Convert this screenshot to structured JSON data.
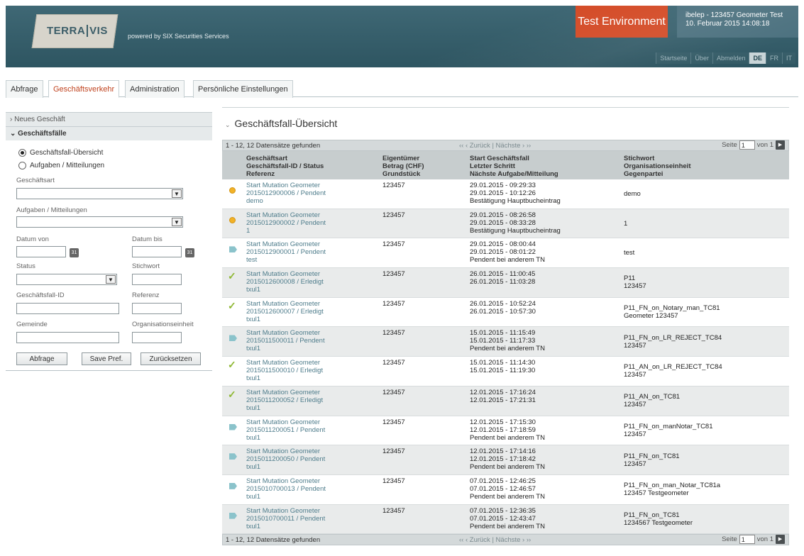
{
  "header": {
    "logo_left": "TERRA",
    "logo_right": "VIS",
    "powered_by": "powered by SIX Securities Services",
    "environment": "Test Environment",
    "user_line1": "ibelep - 123457  Geometer Test",
    "user_line2": "10. Februar 2015 14:08:18",
    "links": [
      "Startseite",
      "Über",
      "Abmelden",
      "DE",
      "FR",
      "IT"
    ],
    "active_lang": "DE"
  },
  "tabs": [
    {
      "label": "Abfrage",
      "active": false
    },
    {
      "label": "Geschäftsverkehr",
      "active": true
    },
    {
      "label": "Administration",
      "active": false
    },
    {
      "label": "Persönliche Einstellungen",
      "active": false
    }
  ],
  "sidebar": {
    "sections": [
      "Neues Geschäft",
      "Geschäftsfälle"
    ],
    "radios": [
      {
        "label": "Geschäftsfall-Übersicht",
        "checked": true
      },
      {
        "label": "Aufgaben / Mitteilungen",
        "checked": false
      }
    ],
    "labels": {
      "geschaeftsart": "Geschäftsart",
      "aufgaben": "Aufgaben / Mitteilungen",
      "datum_von": "Datum von",
      "datum_bis": "Datum bis",
      "status": "Status",
      "stichwort": "Stichwort",
      "geschaeftsfall_id": "Geschäftsfall-ID",
      "referenz": "Referenz",
      "gemeinde": "Gemeinde",
      "organisationseinheit": "Organisationseinheit"
    },
    "buttons": {
      "query": "Abfrage",
      "save": "Save Pref.",
      "reset": "Zurücksetzen"
    }
  },
  "main": {
    "title": "Geschäftsfall-Übersicht",
    "pager": {
      "count": "1 - 12, 12 Datensätze gefunden",
      "nav": "‹‹   ‹ Zurück  |  Nächste ›   ››",
      "page_label": "Seite",
      "page_value": "1",
      "of_label": "von 1"
    },
    "headers": [
      [
        "Geschäftsart",
        "Geschäftsfall-ID / Status",
        "Referenz"
      ],
      [
        "Eigentümer",
        "Betrag (CHF)",
        "Grundstück"
      ],
      [
        "Start Geschäftsfall",
        "Letzter Schritt",
        "Nächste Aufgabe/Mitteilung"
      ],
      [
        "Stichwort",
        "Organisationseinheit",
        "Gegenpartei"
      ]
    ],
    "rows": [
      {
        "status": "dot",
        "art": "Start Mutation Geometer",
        "id": "2015012900006 / Pendent",
        "ref": "demo",
        "owner": "123457",
        "start": "29.01.2015 - 09:29:33",
        "last": "29.01.2015 - 10:12:26",
        "next": "Bestätigung Hauptbucheintrag",
        "kw1": "demo",
        "kw2": ""
      },
      {
        "status": "dot",
        "art": "Start Mutation Geometer",
        "id": "2015012900002 / Pendent",
        "ref": "1",
        "owner": "123457",
        "start": "29.01.2015 - 08:26:58",
        "last": "29.01.2015 - 08:33:28",
        "next": "Bestätigung Hauptbucheintrag",
        "kw1": "1",
        "kw2": ""
      },
      {
        "status": "tag",
        "art": "Start Mutation Geometer",
        "id": "2015012900001 / Pendent",
        "ref": "test",
        "owner": "123457",
        "start": "29.01.2015 - 08:00:44",
        "last": "29.01.2015 - 08:01:22",
        "next": "Pendent bei anderem TN",
        "kw1": "test",
        "kw2": ""
      },
      {
        "status": "check",
        "art": "Start Mutation Geometer",
        "id": "2015012600008 / Erledigt",
        "ref": "txul1",
        "owner": "123457",
        "start": "26.01.2015 - 11:00:45",
        "last": "26.01.2015 - 11:03:28",
        "next": "",
        "kw1": "P11",
        "kw2": "123457"
      },
      {
        "status": "check",
        "art": "Start Mutation Geometer",
        "id": "2015012600007 / Erledigt",
        "ref": "txul1",
        "owner": "123457",
        "start": "26.01.2015 - 10:52:24",
        "last": "26.01.2015 - 10:57:30",
        "next": "",
        "kw1": "P11_FN_on_Notary_man_TC81",
        "kw2": "Geometer 123457"
      },
      {
        "status": "tag",
        "art": "Start Mutation Geometer",
        "id": "2015011500011 / Pendent",
        "ref": "txul1",
        "owner": "123457",
        "start": "15.01.2015 - 11:15:49",
        "last": "15.01.2015 - 11:17:33",
        "next": "Pendent bei anderem TN",
        "kw1": "P11_FN_on_LR_REJECT_TC84",
        "kw2": "123457"
      },
      {
        "status": "check",
        "art": "Start Mutation Geometer",
        "id": "2015011500010 / Erledigt",
        "ref": "txul1",
        "owner": "123457",
        "start": "15.01.2015 - 11:14:30",
        "last": "15.01.2015 - 11:19:30",
        "next": "",
        "kw1": "P11_AN_on_LR_REJECT_TC84",
        "kw2": "123457"
      },
      {
        "status": "check",
        "art": "Start Mutation Geometer",
        "id": "2015011200052 / Erledigt",
        "ref": "txul1",
        "owner": "123457",
        "start": "12.01.2015 - 17:16:24",
        "last": "12.01.2015 - 17:21:31",
        "next": "",
        "kw1": "P11_AN_on_TC81",
        "kw2": "123457"
      },
      {
        "status": "tag",
        "art": "Start Mutation Geometer",
        "id": "2015011200051 / Pendent",
        "ref": "txul1",
        "owner": "123457",
        "start": "12.01.2015 - 17:15:30",
        "last": "12.01.2015 - 17:18:59",
        "next": "Pendent bei anderem TN",
        "kw1": "P11_FN_on_manNotar_TC81",
        "kw2": "123457"
      },
      {
        "status": "tag",
        "art": "Start Mutation Geometer",
        "id": "2015011200050 / Pendent",
        "ref": "txul1",
        "owner": "123457",
        "start": "12.01.2015 - 17:14:16",
        "last": "12.01.2015 - 17:18:42",
        "next": "Pendent bei anderem TN",
        "kw1": "P11_FN_on_TC81",
        "kw2": "123457"
      },
      {
        "status": "tag",
        "art": "Start Mutation Geometer",
        "id": "2015010700013 / Pendent",
        "ref": "txul1",
        "owner": "123457",
        "start": "07.01.2015 - 12:46:25",
        "last": "07.01.2015 - 12:46:57",
        "next": "Pendent bei anderem TN",
        "kw1": "P11_FN_on_man_Notar_TC81a",
        "kw2": "123457 Testgeometer"
      },
      {
        "status": "tag",
        "art": "Start Mutation Geometer",
        "id": "2015010700011 / Pendent",
        "ref": "txul1",
        "owner": "123457",
        "start": "07.01.2015 - 12:36:35",
        "last": "07.01.2015 - 12:43:47",
        "next": "Pendent bei anderem TN",
        "kw1": "P11_FN_on_TC81",
        "kw2": "1234567 Testgeometer"
      }
    ]
  }
}
